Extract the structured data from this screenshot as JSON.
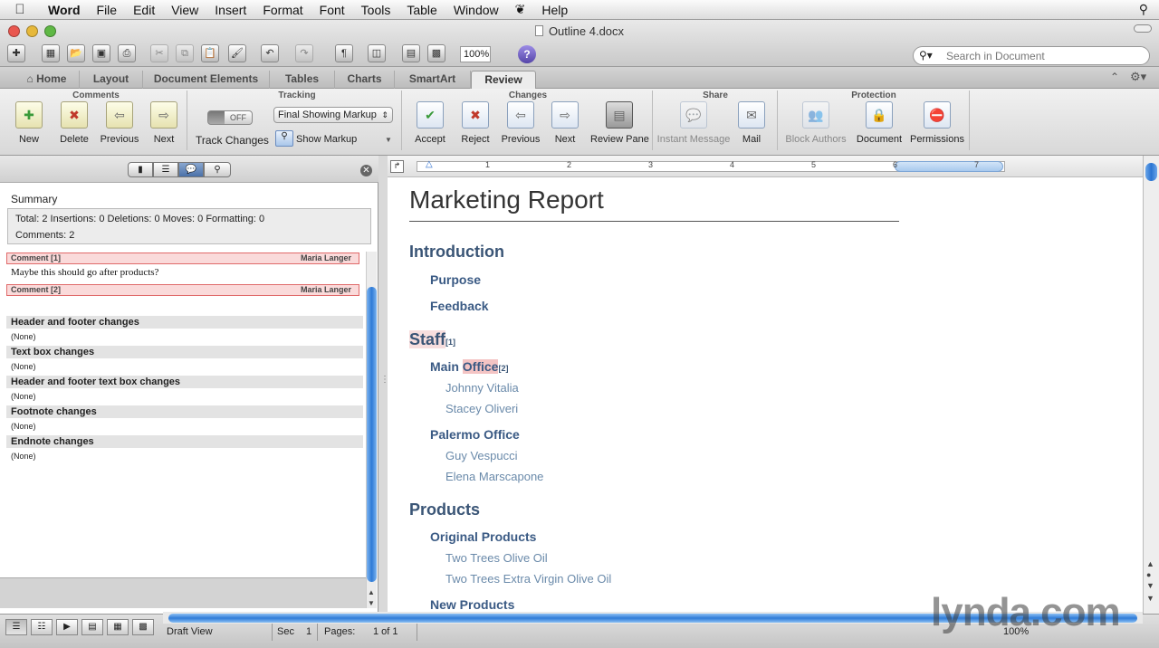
{
  "menubar": {
    "app": "Word",
    "items": [
      "File",
      "Edit",
      "View",
      "Insert",
      "Format",
      "Font",
      "Tools",
      "Table",
      "Window",
      "Help"
    ]
  },
  "window": {
    "title": "Outline 4.docx",
    "zoom": "100%",
    "search_placeholder": "Search in Document"
  },
  "tabs": [
    "Home",
    "Layout",
    "Document Elements",
    "Tables",
    "Charts",
    "SmartArt",
    "Review"
  ],
  "active_tab": "Review",
  "ribbon": {
    "groups": [
      "Comments",
      "Tracking",
      "Changes",
      "Share",
      "Protection"
    ],
    "comments": {
      "new": "New",
      "delete": "Delete",
      "previous": "Previous",
      "next": "Next"
    },
    "tracking": {
      "toggle": "OFF",
      "markup_select": "Final Showing Markup",
      "track_changes": "Track Changes",
      "show_markup": "Show Markup"
    },
    "changes": {
      "accept": "Accept",
      "reject": "Reject",
      "previous": "Previous",
      "next": "Next",
      "review_pane": "Review Pane"
    },
    "share": {
      "instant_message": "Instant Message",
      "mail": "Mail"
    },
    "protection": {
      "block_authors": "Block Authors",
      "document": "Document",
      "permissions": "Permissions"
    }
  },
  "review_pane": {
    "summary_label": "Summary",
    "summary_line1": "Total: 2   Insertions: 0   Deletions: 0   Moves: 0   Formatting: 0",
    "summary_line2": "Comments: 2",
    "comments": [
      {
        "label": "Comment [1]",
        "author": "Maria Langer",
        "text": "Maybe this should go after products?"
      },
      {
        "label": "Comment [2]",
        "author": "Maria Langer",
        "text": ""
      }
    ],
    "sections": [
      {
        "title": "Header and footer changes",
        "value": "(None)"
      },
      {
        "title": "Text box changes",
        "value": "(None)"
      },
      {
        "title": "Header and footer text box changes",
        "value": "(None)"
      },
      {
        "title": "Footnote changes",
        "value": "(None)"
      },
      {
        "title": "Endnote changes",
        "value": "(None)"
      }
    ]
  },
  "ruler": {
    "numbers": [
      "1",
      "2",
      "3",
      "4",
      "5",
      "6",
      "7"
    ]
  },
  "document": {
    "title": "Marketing Report",
    "h_intro": "Introduction",
    "purpose": "Purpose",
    "feedback": "Feedback",
    "staff": "Staff",
    "staff_mark": "[1]",
    "main": "Main ",
    "office": "Office",
    "office_mark": "[2]",
    "p1": "Johnny Vitalia",
    "p2": "Stacey Oliveri",
    "palermo": "Palermo Office",
    "p3": "Guy Vespucci",
    "p4": "Elena Marscapone",
    "products": "Products",
    "orig": "Original Products",
    "o1": "Two Trees Olive Oil",
    "o2": "Two Trees Extra Virgin Olive Oil",
    "newp": "New Products"
  },
  "status": {
    "view": "Draft View",
    "sec_label": "Sec",
    "sec_value": "1",
    "pages_label": "Pages:",
    "pages_value": "1 of 1",
    "zoom": "100%"
  },
  "watermark": "lynda.com",
  "colors": {
    "accent": "#2f7bd7",
    "heading": "#3a5576",
    "comment_bg": "#fadada",
    "comment_border": "#e06a6a"
  }
}
